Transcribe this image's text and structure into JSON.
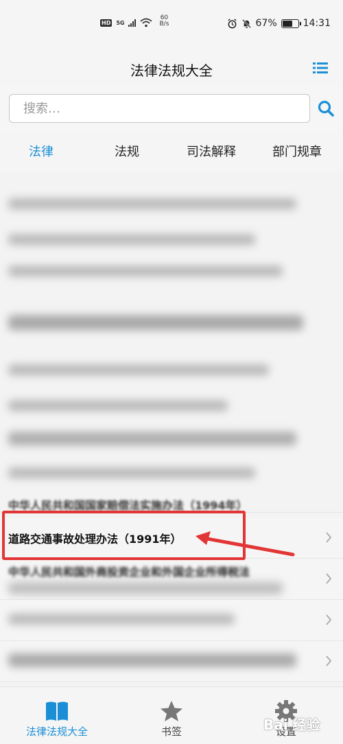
{
  "status_bar": {
    "hd": "HD",
    "sig_label": "5G",
    "net_speed_value": "60",
    "net_speed_unit": "B/s",
    "battery_percent": "67%",
    "battery_level": 0.67,
    "time": "14:31"
  },
  "header": {
    "title": "法律法规大全",
    "menu_icon": "list-menu-icon"
  },
  "search": {
    "placeholder": "搜索…",
    "icon": "search-icon"
  },
  "tabs": [
    {
      "label": "法律",
      "active": true
    },
    {
      "label": "法规",
      "active": false
    },
    {
      "label": "司法解释",
      "active": false
    },
    {
      "label": "部门规章",
      "active": false
    }
  ],
  "list": {
    "partial_top_text": "中华人民共和国国家赔偿法实施办法（1994年）",
    "highlighted_item": "道路交通事故处理办法（1991年）",
    "partial_below_text": "中华人民共和国外商投资企业和外国企业所得税法"
  },
  "bottom_nav": [
    {
      "label": "法律法规大全",
      "icon": "book-icon",
      "active": true
    },
    {
      "label": "书签",
      "icon": "star-icon",
      "active": false
    },
    {
      "label": "设置",
      "icon": "gear-icon",
      "active": false
    }
  ],
  "watermark": "Bai 经验",
  "colors": {
    "accent": "#1a8fd6",
    "highlight": "#e23636"
  }
}
